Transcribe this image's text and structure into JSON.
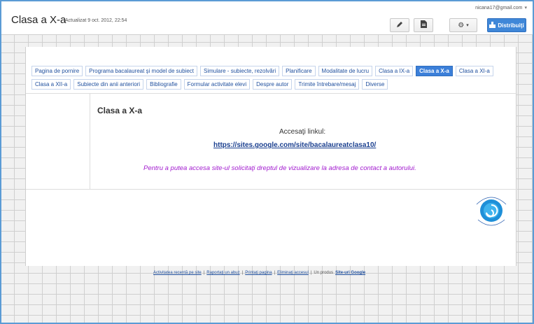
{
  "header": {
    "site_title": "Clasa a X-a",
    "updated": "Actualizat 9 oct. 2012, 22:54",
    "account": "nicana17@gmail.com",
    "share_label": "Distribuiţi",
    "icons": [
      "pencil-icon",
      "page-icon",
      "gear-icon",
      "share-icon"
    ]
  },
  "nav": {
    "items": [
      "Pagina de pornire",
      "Programa bacalaureat şi model de subiect",
      "Simulare - subiecte, rezolvări",
      "Planificare",
      "Modalitate de lucru",
      "Clasa a IX-a",
      "Clasa a X-a",
      "Clasa a XI-a",
      "Clasa a XII-a",
      "Subiecte din anii anteriori",
      "Bibliografie",
      "Formular activitate elevi",
      "Despre autor",
      "Trimite întrebare/mesaj",
      "Diverse"
    ],
    "active_index": 6
  },
  "content": {
    "title": "Clasa a X-a",
    "access_label": "Accesaţi linkul:",
    "link": "https://sites.google.com/site/bacalaureatclasa10/",
    "note": "Pentru a putea accesa site-ul solicitaţi dreptul de vizualizare la adresa de contact a autorului."
  },
  "footer": {
    "recent": "Activitatea recentă pe site",
    "sep1": "|",
    "report": "Raportaţi un abuz",
    "sep2": "|",
    "print": "Printaţi pagina",
    "sep3": "|",
    "remove": "Eliminaţi accesul",
    "sep4": "|",
    "powered": "Un produs",
    "google": "Site-uri Google"
  },
  "colors": {
    "accent": "#3b7fd9",
    "link": "#1f4f9e",
    "note": "#a21bcf"
  }
}
